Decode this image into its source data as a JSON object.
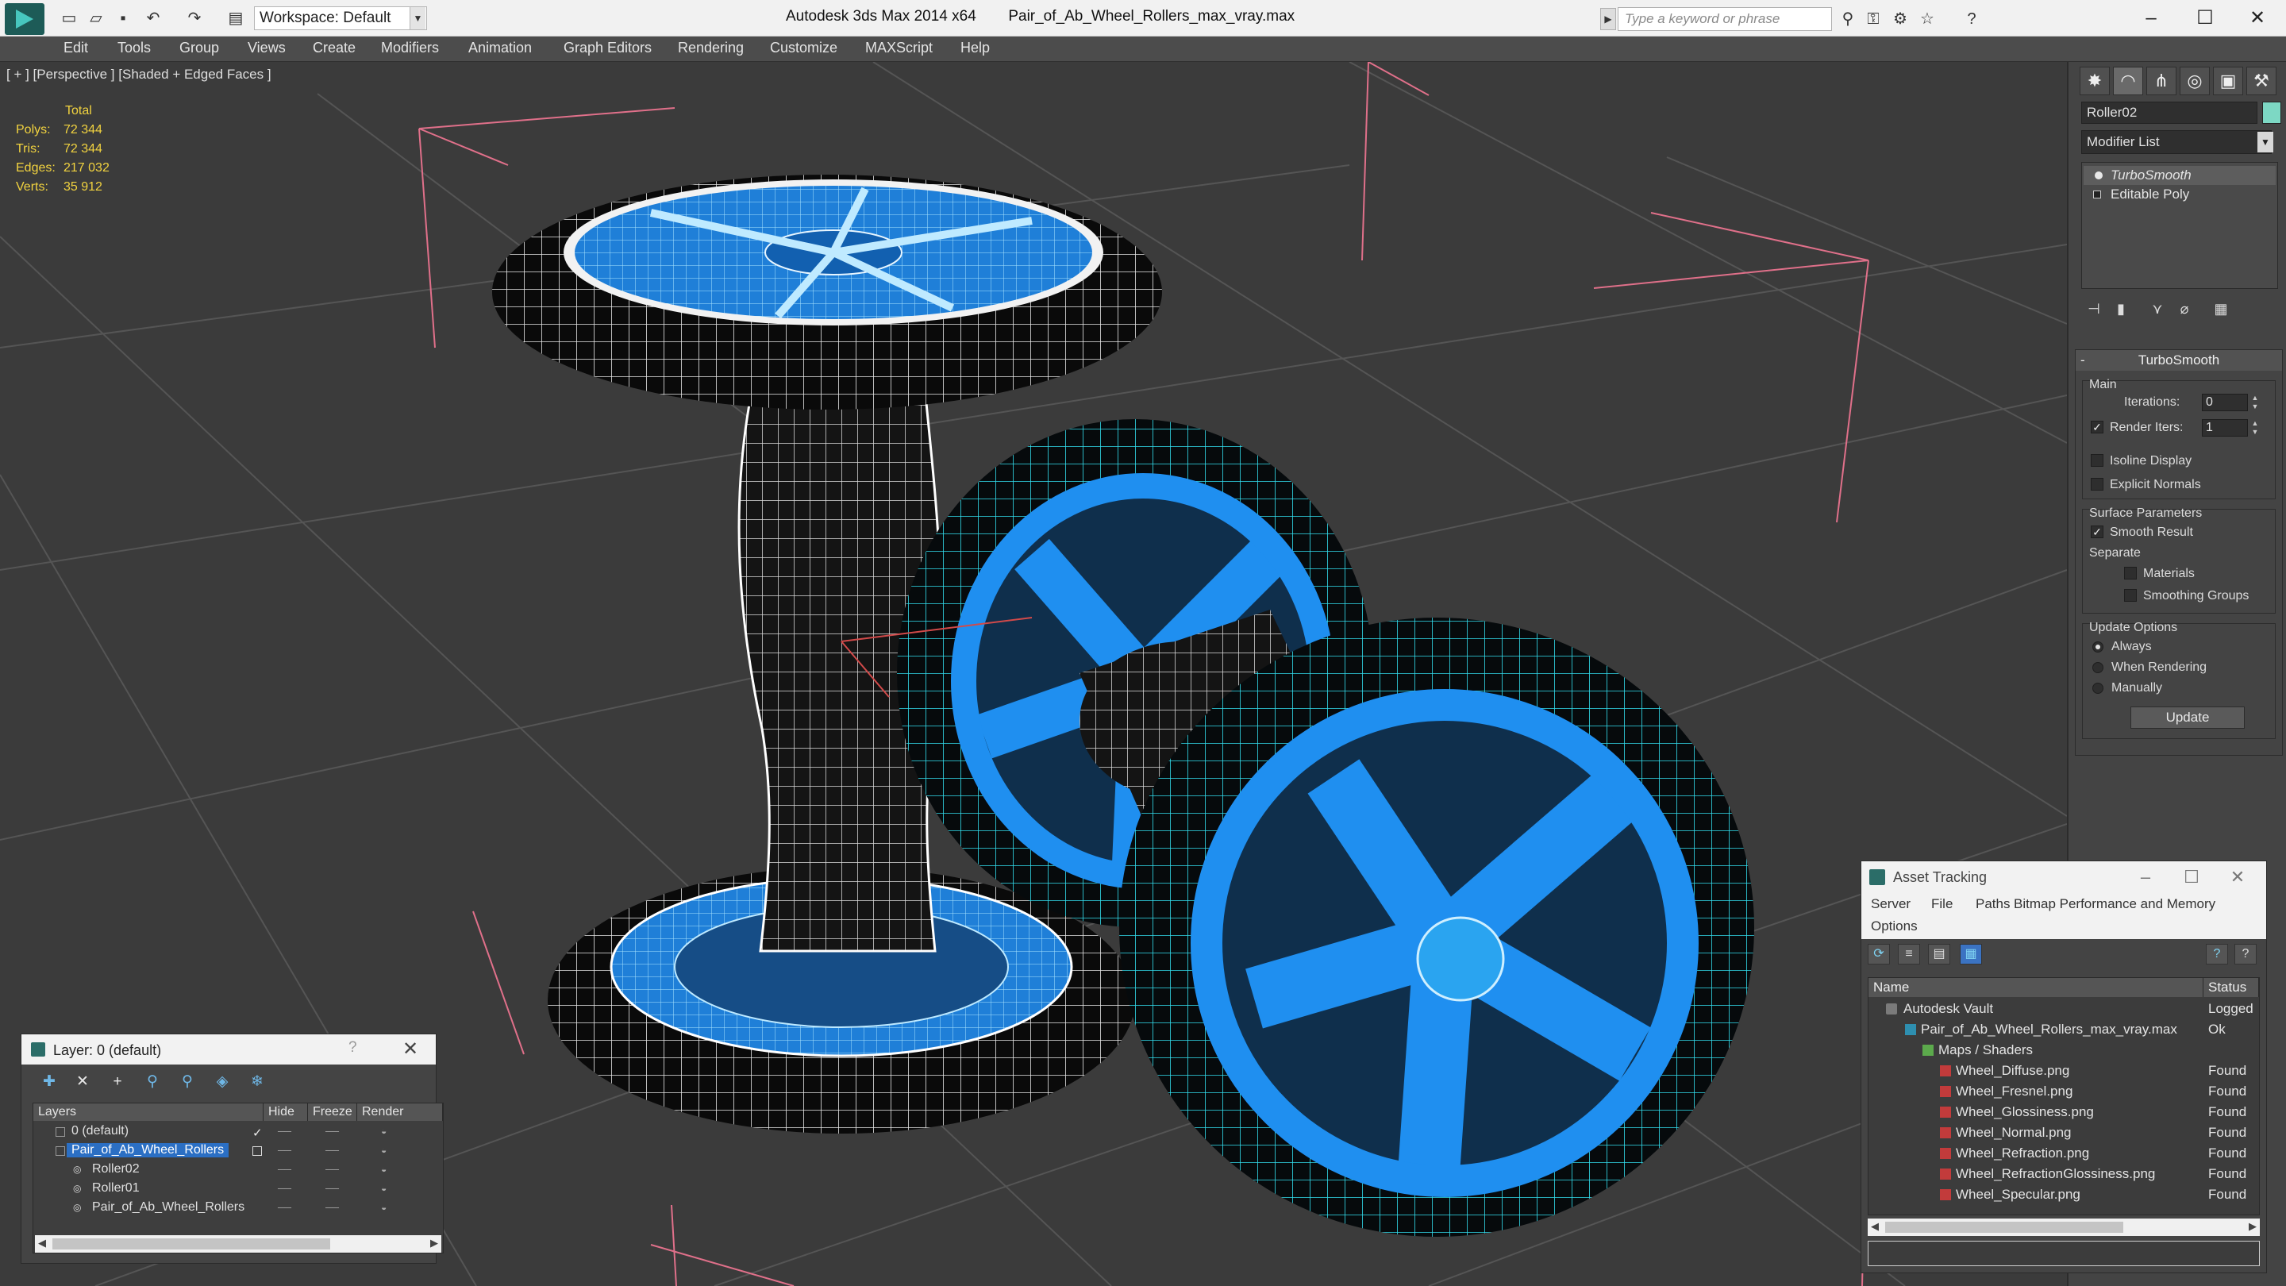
{
  "titlebar": {
    "workspace": "Workspace: Default",
    "app_name": "Autodesk 3ds Max  2014 x64",
    "file_name": "Pair_of_Ab_Wheel_Rollers_max_vray.max",
    "search_placeholder": "Type a keyword or phrase"
  },
  "menu": [
    "Edit",
    "Tools",
    "Group",
    "Views",
    "Create",
    "Modifiers",
    "Animation",
    "Graph Editors",
    "Rendering",
    "Customize",
    "MAXScript",
    "Help"
  ],
  "viewport": {
    "label": "[ + ] [Perspective ] [Shaded + Edged Faces ]",
    "stats_header": "Total",
    "stats": [
      {
        "label": "Polys:",
        "value": "72 344"
      },
      {
        "label": "Tris:",
        "value": "72 344"
      },
      {
        "label": "Edges:",
        "value": "217 032"
      },
      {
        "label": "Verts:",
        "value": "35 912"
      }
    ]
  },
  "command_panel": {
    "object_name": "Roller02",
    "object_color": "#7dd8c4",
    "modifier_list": "Modifier List",
    "stack": [
      {
        "label": "TurboSmooth",
        "selected": true
      },
      {
        "label": "Editable Poly",
        "selected": false
      }
    ],
    "rollout": {
      "title": "TurboSmooth",
      "main_group": "Main",
      "iterations_label": "Iterations:",
      "iterations_value": "0",
      "render_iters_label": "Render Iters:",
      "render_iters_value": "1",
      "isoline_label": "Isoline Display",
      "explicit_normals_label": "Explicit Normals",
      "surface_group": "Surface Parameters",
      "smooth_result_label": "Smooth Result",
      "separate_label": "Separate",
      "materials_label": "Materials",
      "smoothing_groups_label": "Smoothing Groups",
      "update_group": "Update Options",
      "always_label": "Always",
      "when_rendering_label": "When Rendering",
      "manually_label": "Manually",
      "update_button": "Update"
    }
  },
  "layer_dialog": {
    "title": "Layer: 0 (default)",
    "help": "?",
    "columns": [
      "Layers",
      "Hide",
      "Freeze",
      "Render"
    ],
    "rows": [
      {
        "name": "0 (default)",
        "indent": 0,
        "selected": false
      },
      {
        "name": "Pair_of_Ab_Wheel_Rollers",
        "indent": 0,
        "selected": true
      },
      {
        "name": "Roller02",
        "indent": 1,
        "selected": false
      },
      {
        "name": "Roller01",
        "indent": 1,
        "selected": false
      },
      {
        "name": "Pair_of_Ab_Wheel_Rollers",
        "indent": 1,
        "selected": false
      }
    ]
  },
  "asset_dialog": {
    "title": "Asset Tracking",
    "menu": [
      "Server",
      "File",
      "Paths",
      "Bitmap Performance and Memory",
      "Options"
    ],
    "columns": [
      "Name",
      "Status"
    ],
    "rows": [
      {
        "name": "Autodesk Vault",
        "status": "Logged",
        "indent": 0
      },
      {
        "name": "Pair_of_Ab_Wheel_Rollers_max_vray.max",
        "status": "Ok",
        "indent": 1
      },
      {
        "name": "Maps / Shaders",
        "status": "",
        "indent": 2
      },
      {
        "name": "Wheel_Diffuse.png",
        "status": "Found",
        "indent": 3
      },
      {
        "name": "Wheel_Fresnel.png",
        "status": "Found",
        "indent": 3
      },
      {
        "name": "Wheel_Glossiness.png",
        "status": "Found",
        "indent": 3
      },
      {
        "name": "Wheel_Normal.png",
        "status": "Found",
        "indent": 3
      },
      {
        "name": "Wheel_Refraction.png",
        "status": "Found",
        "indent": 3
      },
      {
        "name": "Wheel_RefractionGlossiness.png",
        "status": "Found",
        "indent": 3
      },
      {
        "name": "Wheel_Specular.png",
        "status": "Found",
        "indent": 3
      }
    ]
  },
  "colors": {
    "viewport_bg": "#3b3b3b",
    "wire_white": "#ffffff",
    "wire_cyan": "#32e0f0",
    "hub_blue": "#1f7fd8",
    "stats_yellow": "#f2d33f",
    "selection_bracket": "#e0708a"
  }
}
